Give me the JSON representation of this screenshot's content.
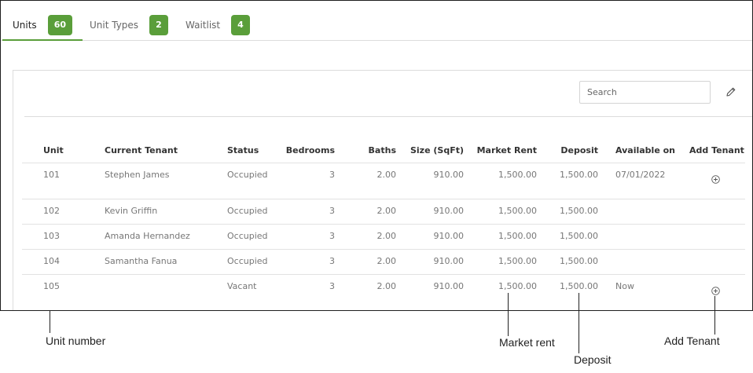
{
  "tabs": [
    {
      "label": "Units",
      "count": "60",
      "active": true
    },
    {
      "label": "Unit Types",
      "count": "2",
      "active": false
    },
    {
      "label": "Waitlist",
      "count": "4",
      "active": false
    }
  ],
  "toolbar": {
    "search_placeholder": "Search",
    "edit_icon": "pencil-icon"
  },
  "table": {
    "headers": {
      "unit": "Unit",
      "tenant": "Current Tenant",
      "status": "Status",
      "bedrooms": "Bedrooms",
      "baths": "Baths",
      "size": "Size (SqFt)",
      "market_rent": "Market Rent",
      "deposit": "Deposit",
      "available_on": "Available on",
      "add_tenant": "Add Tenant"
    },
    "rows": [
      {
        "unit": "101",
        "tenant": "Stephen James",
        "status": "Occupied",
        "bedrooms": "3",
        "baths": "2.00",
        "size": "910.00",
        "market_rent": "1,500.00",
        "deposit": "1,500.00",
        "available_on": "07/01/2022",
        "add": true
      },
      {
        "unit": "102",
        "tenant": "Kevin Griffin",
        "status": "Occupied",
        "bedrooms": "3",
        "baths": "2.00",
        "size": "910.00",
        "market_rent": "1,500.00",
        "deposit": "1,500.00",
        "available_on": "",
        "add": false
      },
      {
        "unit": "103",
        "tenant": "Amanda Hernandez",
        "status": "Occupied",
        "bedrooms": "3",
        "baths": "2.00",
        "size": "910.00",
        "market_rent": "1,500.00",
        "deposit": "1,500.00",
        "available_on": "",
        "add": false
      },
      {
        "unit": "104",
        "tenant": "Samantha Fanua",
        "status": "Occupied",
        "bedrooms": "3",
        "baths": "2.00",
        "size": "910.00",
        "market_rent": "1,500.00",
        "deposit": "1,500.00",
        "available_on": "",
        "add": false
      },
      {
        "unit": "105",
        "tenant": "",
        "status": "Vacant",
        "bedrooms": "3",
        "baths": "2.00",
        "size": "910.00",
        "market_rent": "1,500.00",
        "deposit": "1,500.00",
        "available_on": "Now",
        "add": true
      }
    ]
  },
  "callouts": {
    "unit_number": "Unit number",
    "market_rent": "Market rent",
    "deposit": "Deposit",
    "add_tenant": "Add Tenant"
  },
  "colors": {
    "accent": "#5a9e3a"
  }
}
